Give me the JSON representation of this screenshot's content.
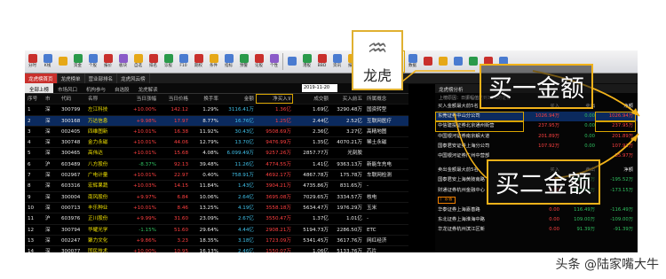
{
  "toolbar": [
    {
      "label": "分时",
      "color": "#c9302c"
    },
    {
      "label": "K线",
      "color": "#4a7bd0"
    },
    {
      "label": "",
      "color": "#e6a817"
    },
    {
      "label": "资金",
      "color": "#2a9a4a"
    },
    {
      "label": "个股",
      "color": "#4a7bd0"
    },
    {
      "label": "报价",
      "color": "#c9302c"
    },
    {
      "label": "板块",
      "color": "#8a5ac8"
    },
    {
      "label": "自选",
      "color": "#e6a817"
    },
    {
      "label": "排名",
      "color": "#c9302c"
    },
    {
      "label": "诊股",
      "color": "#2a9a4a"
    },
    {
      "label": "F10",
      "color": "#4a7bd0"
    },
    {
      "label": "期权",
      "color": "#c9302c"
    },
    {
      "label": "条件",
      "color": "#e6a817"
    },
    {
      "label": "指标",
      "color": "#4a7bd0"
    },
    {
      "label": "预警",
      "color": "#2a9a4a"
    },
    {
      "label": "论股",
      "color": "#c9302c"
    },
    {
      "label": "个性",
      "color": "#8a5ac8"
    },
    {
      "label": "",
      "color": "#4a7bd0"
    },
    {
      "label": "港股",
      "color": "#2a9a4a"
    },
    {
      "label": "BBD",
      "color": "#c9302c"
    },
    {
      "label": "资讯",
      "color": "#4a7bd0"
    },
    {
      "label": "报告",
      "color": "#e6a817"
    },
    {
      "label": "沪港",
      "color": "#c9302c"
    },
    {
      "label": "深港",
      "color": "#2a9a4a"
    },
    {
      "label": "龙虎",
      "color": "#888888",
      "highlight": true
    },
    {
      "label": "数据",
      "color": "#4a7bd0"
    },
    {
      "label": "",
      "color": "#c9302c"
    },
    {
      "label": "",
      "color": "#e6a817"
    },
    {
      "label": "",
      "color": "#4a7bd0"
    },
    {
      "label": "",
      "color": "#2a9a4a"
    },
    {
      "label": "",
      "color": "#c9302c"
    },
    {
      "label": "",
      "color": "#4a7bd0"
    }
  ],
  "tabs1": [
    "龙虎榜首页",
    "龙虎榜单",
    "营业部排名",
    "龙虎风云榜"
  ],
  "tabs2": [
    "全部上榜",
    "市场风口",
    "机构参与",
    "自选股",
    "龙虎解读"
  ],
  "date": "2019-11-20",
  "columns": [
    "序号",
    "市",
    "代码",
    "名称",
    "当日涨幅",
    "当日价格",
    "换手率",
    "金额",
    "净买入⊽",
    "成交额",
    "买入前五",
    "所属概念"
  ],
  "rows": [
    [
      "1",
      "深",
      "300799",
      "左江科技",
      "+10.00%",
      "142.12",
      "1.29%",
      "3116.41万",
      "1.36亿",
      "1.69亿",
      "3290.48万",
      "国资转型"
    ],
    [
      "2",
      "深",
      "300168",
      "万达信息",
      "+9.98%",
      "17.97",
      "8.77%",
      "16.76亿",
      "1.25亿",
      "2.44亿",
      "2.52亿",
      "互联网医疗"
    ],
    [
      "3",
      "深",
      "002405",
      "四维图新",
      "+10.01%",
      "16.38",
      "11.92%",
      "30.43亿",
      "9508.69万",
      "2.36亿",
      "3.27亿",
      "高精地图"
    ],
    [
      "4",
      "深",
      "300748",
      "金力永磁",
      "+10.01%",
      "44.06",
      "12.79%",
      "13.70亿",
      "9476.99万",
      "1.35亿",
      "4070.21万",
      "稀土永磁"
    ],
    [
      "5",
      "深",
      "300465",
      "高伟达",
      "+10.01%",
      "15.68",
      "4.08%",
      "6.099.49万",
      "9257.26万",
      "2857.77万",
      "光刻胶"
    ],
    [
      "6",
      "沪",
      "603489",
      "八方股份",
      "-8.37%",
      "92.13",
      "39.48%",
      "11.26亿",
      "4774.55万",
      "1.41亿",
      "9363.13万",
      "新能车充电"
    ],
    [
      "7",
      "深",
      "002967",
      "广电计量",
      "+10.01%",
      "22.97",
      "0.40%",
      "758.91万",
      "4692.17万",
      "4867.78万",
      "175.78万",
      "车联网检测"
    ],
    [
      "8",
      "深",
      "603316",
      "宏辉果蔬",
      "+10.03%",
      "14.15",
      "11.84%",
      "1.43亿",
      "3904.21万",
      "4735.86万",
      "831.65万",
      "-"
    ],
    [
      "9",
      "深",
      "300004",
      "南风股份",
      "+9.97%",
      "6.84",
      "10.06%",
      "2.64亿",
      "3695.08万",
      "7029.65万",
      "3334.57万",
      "核电"
    ],
    [
      "10",
      "深",
      "000713",
      "丰乐种业",
      "+10.01%",
      "8.46",
      "13.25%",
      "4.19亿",
      "3558.18万",
      "5634.47万",
      "1976.29万",
      "玉米"
    ],
    [
      "11",
      "沪",
      "603976",
      "正川股份",
      "+9.99%",
      "31.60",
      "23.09%",
      "2.67亿",
      "3550.47万",
      "1.37亿",
      "1.01亿",
      "-"
    ],
    [
      "12",
      "深",
      "300794",
      "华耀光学",
      "-1.15%",
      "51.60",
      "29.64%",
      "4.44亿",
      "2908.21万",
      "5194.73万",
      "2286.50万",
      "ETC"
    ],
    [
      "13",
      "深",
      "002247",
      "聚力文化",
      "+9.86%",
      "3.23",
      "18.35%",
      "3.18亿",
      "1723.09万",
      "5341.45万",
      "3617.76万",
      "网红经济"
    ],
    [
      "14",
      "深",
      "300077",
      "国民技术",
      "+10.00%",
      "10.95",
      "16.13%",
      "2.46亿",
      "1550.07万",
      "1.06亿",
      "5133.76万",
      "芯片"
    ]
  ],
  "side": {
    "title": "龙虎榜分析",
    "subtitle": "上榜原因：日振幅值达到15%的证券",
    "buy_header": [
      "买入金额最大前5名",
      "买入",
      "卖出",
      "净额"
    ],
    "buy_rows": [
      [
        "东莞证券中山分公司",
        "1026.94万",
        "0.00",
        "1026.94万"
      ],
      [
        "中信建投证券北京通州街营",
        "237.95万",
        "0.00",
        "237.95万"
      ],
      [
        "中国银河证券南京解大道",
        "201.89万",
        "0.00",
        "201.89万"
      ],
      [
        "国泰君安证券上海分公司",
        "107.92万",
        "0.00",
        "107.92万"
      ],
      [
        "中国银河证券广州中营部",
        "",
        "",
        "85.97万"
      ]
    ],
    "sell_header": [
      "卖出金额最大前5名",
      "买入",
      "卖出",
      "净额"
    ],
    "sell_rows": [
      [
        "国泰君安上海黄陂南路",
        "0.00",
        "195.52万",
        "-195.52万"
      ],
      [
        "财通证券杭州金融中心",
        "0.00",
        "173.15万",
        "-173.15万"
      ],
      [
        "广发证",
        "",
        "",
        ""
      ],
      [
        "华泰证券上海嘉善路",
        "0.00",
        "116.49万",
        "-116.49万"
      ],
      [
        "东北证券上海淮海中路",
        "0.00",
        "109.00万",
        "-109.00万"
      ],
      [
        "华龙证券杭州滨江区新",
        "0.00",
        "91.39万",
        "-91.39万"
      ]
    ],
    "sell_badge": "广东省"
  },
  "popup": {
    "label": "龙虎"
  },
  "callouts": {
    "buy1": "买一金额",
    "buy2": "买二金额"
  },
  "watermark": "头条 @陆家嘴大牛",
  "colors": {
    "highlight": "#f1b21a",
    "up": "#ff4040",
    "down": "#30c060",
    "name": "#f0e000"
  }
}
